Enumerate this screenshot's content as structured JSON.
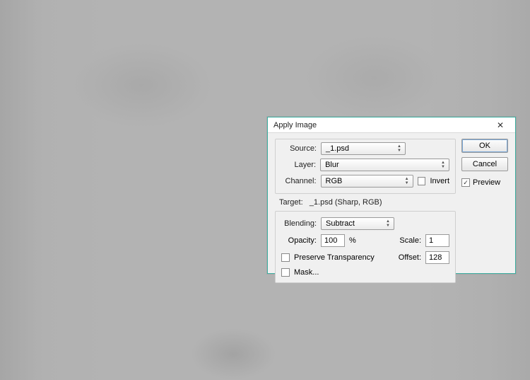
{
  "dialog": {
    "title": "Apply Image",
    "ok_label": "OK",
    "cancel_label": "Cancel",
    "preview_label": "Preview",
    "preview_checked": true
  },
  "source": {
    "source_label": "Source:",
    "source_value": "_1.psd",
    "layer_label": "Layer:",
    "layer_value": "Blur",
    "channel_label": "Channel:",
    "channel_value": "RGB",
    "invert_label": "Invert",
    "invert_checked": false
  },
  "target": {
    "label": "Target:",
    "value": "_1.psd (Sharp, RGB)"
  },
  "blending": {
    "blending_label": "Blending:",
    "blending_value": "Subtract",
    "opacity_label": "Opacity:",
    "opacity_value": "100",
    "opacity_suffix": "%",
    "scale_label": "Scale:",
    "scale_value": "1",
    "offset_label": "Offset:",
    "offset_value": "128",
    "preserve_label": "Preserve Transparency",
    "preserve_checked": false,
    "mask_label": "Mask...",
    "mask_checked": false
  }
}
